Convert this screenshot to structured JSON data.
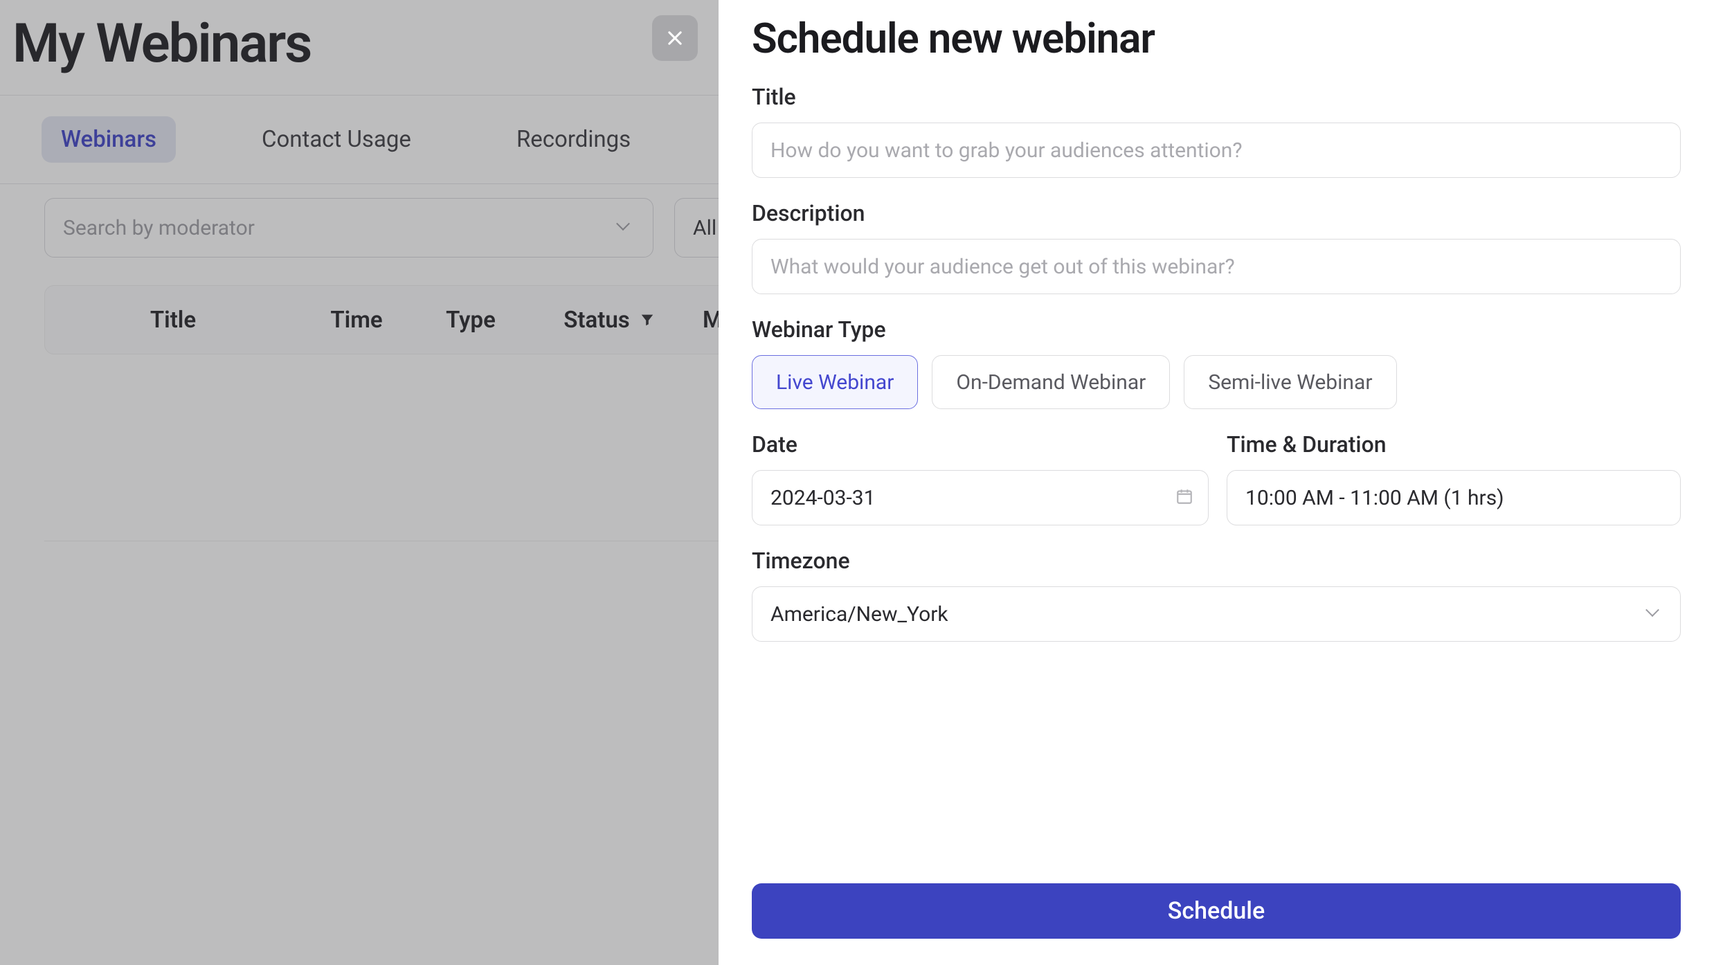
{
  "page": {
    "title": "My Webinars",
    "tabs": [
      {
        "label": "Webinars",
        "active": true
      },
      {
        "label": "Contact Usage",
        "active": false
      },
      {
        "label": "Recordings",
        "active": false
      }
    ],
    "filters": {
      "moderator_placeholder": "Search by moderator",
      "status_value": "All"
    },
    "table": {
      "columns": {
        "title": "Title",
        "time": "Time",
        "type": "Type",
        "status": "Status",
        "more": "M"
      }
    }
  },
  "drawer": {
    "heading": "Schedule new webinar",
    "title": {
      "label": "Title",
      "placeholder": "How do you want to grab your audiences attention?",
      "value": ""
    },
    "description": {
      "label": "Description",
      "placeholder": "What would your audience get out of this webinar?",
      "value": ""
    },
    "webinar_type": {
      "label": "Webinar Type",
      "options": [
        {
          "label": "Live Webinar",
          "active": true
        },
        {
          "label": "On-Demand Webinar",
          "active": false
        },
        {
          "label": "Semi-live Webinar",
          "active": false
        }
      ]
    },
    "date": {
      "label": "Date",
      "value": "2024-03-31"
    },
    "time_duration": {
      "label": "Time & Duration",
      "value": "10:00 AM - 11:00 AM (1 hrs)"
    },
    "timezone": {
      "label": "Timezone",
      "value": "America/New_York"
    },
    "submit_label": "Schedule"
  },
  "colors": {
    "accent": "#3c43bf",
    "accent_soft_bg": "#f4f5fe",
    "accent_soft_border": "#6b6fe0",
    "tab_active_bg": "#e3e6f3",
    "tab_active_fg": "#3b3fc7"
  }
}
